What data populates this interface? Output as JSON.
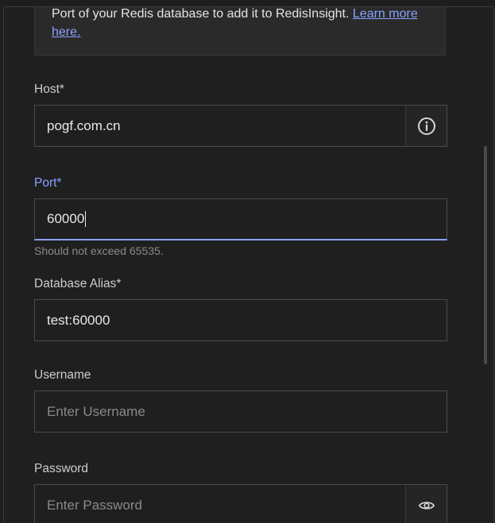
{
  "info": {
    "text": "Port of your Redis database to add it to RedisInsight.",
    "link": "Learn more here."
  },
  "host": {
    "label": "Host*",
    "value": "pogf.com.cn"
  },
  "port": {
    "label": "Port*",
    "value": "60000",
    "helper": "Should not exceed 65535."
  },
  "alias": {
    "label": "Database Alias*",
    "value": "test:60000"
  },
  "username": {
    "label": "Username",
    "placeholder": "Enter Username"
  },
  "password": {
    "label": "Password",
    "placeholder": "Enter Password"
  },
  "colors": {
    "accent": "#8ba2ff",
    "background": "#1f1f1f",
    "border": "#4b4b4b"
  },
  "icons": {
    "host_append": "info-icon",
    "password_append": "eye-icon"
  }
}
